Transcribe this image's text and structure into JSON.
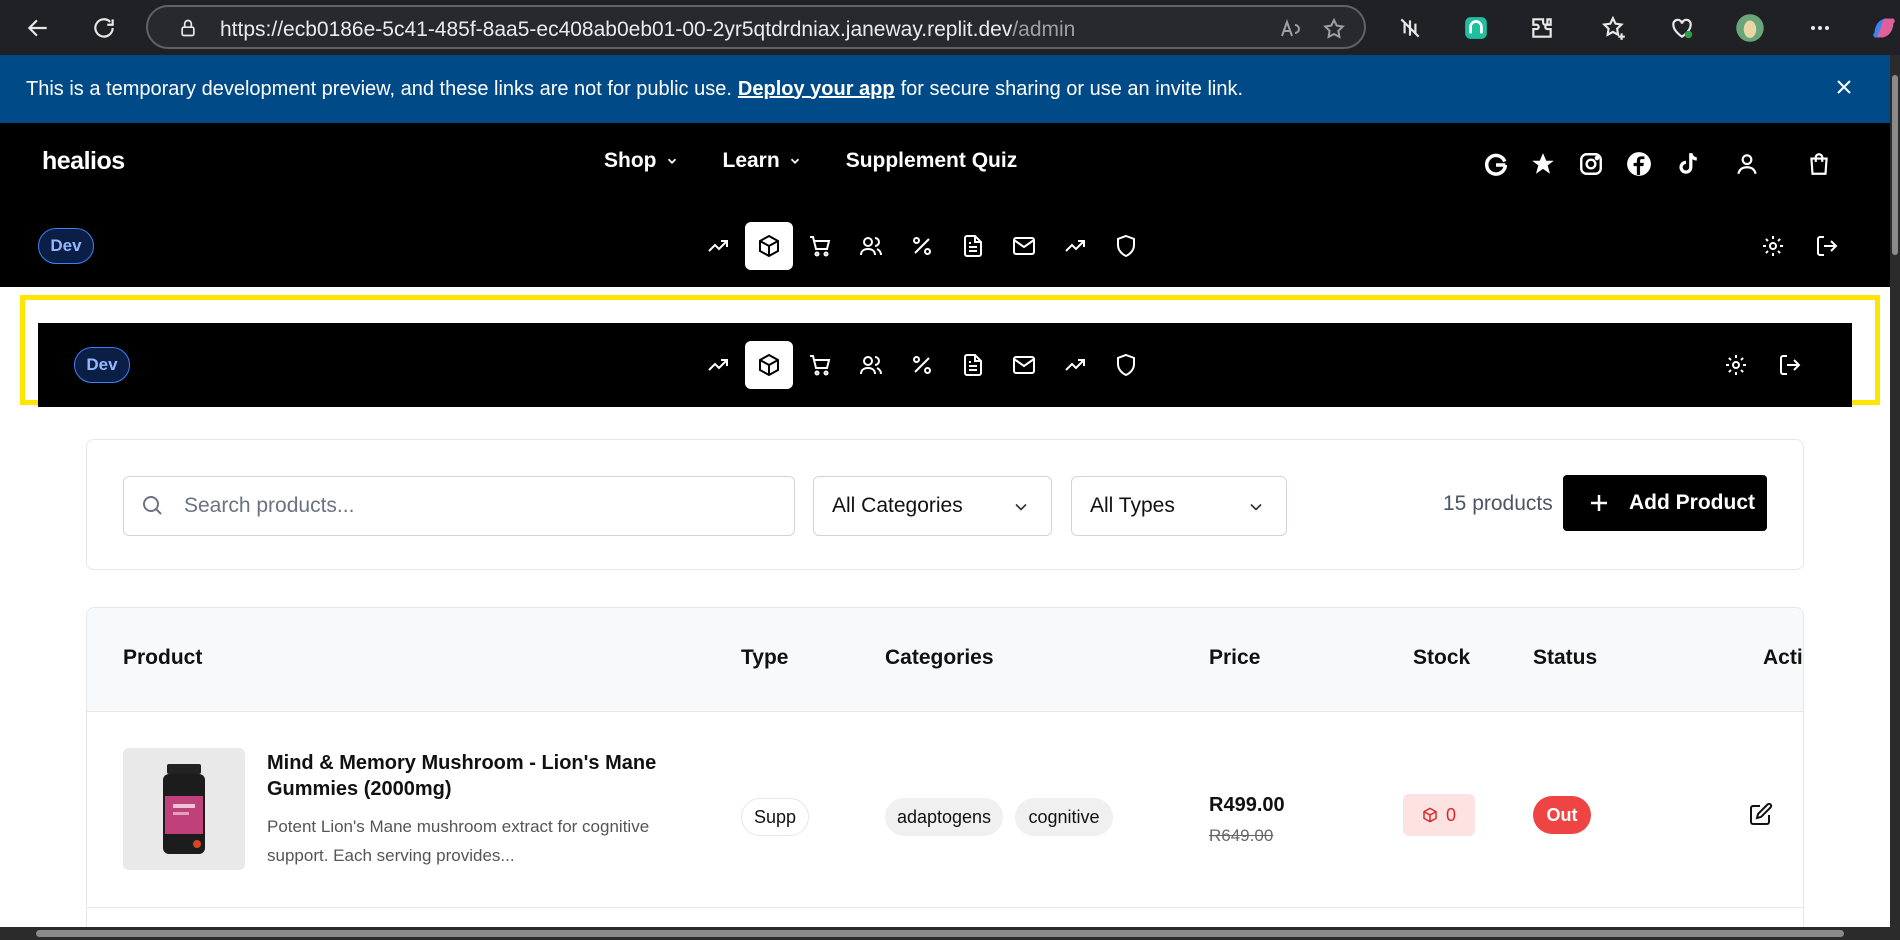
{
  "browser": {
    "url_host": "https://ecb0186e-5c41-485f-8aa5-ec408ab0eb01-00-2yr5qtdrdniax.janeway.replit.dev",
    "url_path": "/admin"
  },
  "banner": {
    "text_before": "This is a temporary development preview, and these links are not for public use.",
    "link": "Deploy your app",
    "text_after": "for secure sharing or use an invite link."
  },
  "header": {
    "logo": "healios",
    "nav": [
      {
        "label": "Shop",
        "has_dropdown": true
      },
      {
        "label": "Learn",
        "has_dropdown": true
      },
      {
        "label": "Supplement Quiz",
        "has_dropdown": false
      }
    ],
    "icons": [
      "google-icon",
      "star-icon",
      "instagram-icon",
      "facebook-icon",
      "tiktok-icon",
      "user-icon",
      "cart-icon"
    ]
  },
  "admin_bar": {
    "badge": "Dev",
    "icons": [
      "analytics-icon",
      "products-icon",
      "orders-icon",
      "customers-icon",
      "discounts-icon",
      "content-icon",
      "email-icon",
      "reports-icon",
      "security-icon"
    ],
    "active_index": 1
  },
  "filters": {
    "search_placeholder": "Search products...",
    "category": "All Categories",
    "type": "All Types",
    "count": "15 products",
    "add_label": "Add Product"
  },
  "table": {
    "headers": {
      "product": "Product",
      "type": "Type",
      "categories": "Categories",
      "price": "Price",
      "stock": "Stock",
      "status": "Status",
      "actions": "Actions"
    },
    "rows": [
      {
        "name": "Mind & Memory Mushroom - Lion's Mane Gummies (2000mg)",
        "description": "Potent Lion's Mane mushroom extract for cognitive support. Each serving provides...",
        "type": "Supp",
        "categories": [
          "adaptogens",
          "cognitive"
        ],
        "price": "R499.00",
        "old_price": "R649.00",
        "stock": "0",
        "status": "Out"
      }
    ]
  },
  "colors": {
    "banner": "#004b87",
    "highlight": "#ffe500",
    "out_status": "#ef4444",
    "stock_bg": "#fde2e2"
  }
}
